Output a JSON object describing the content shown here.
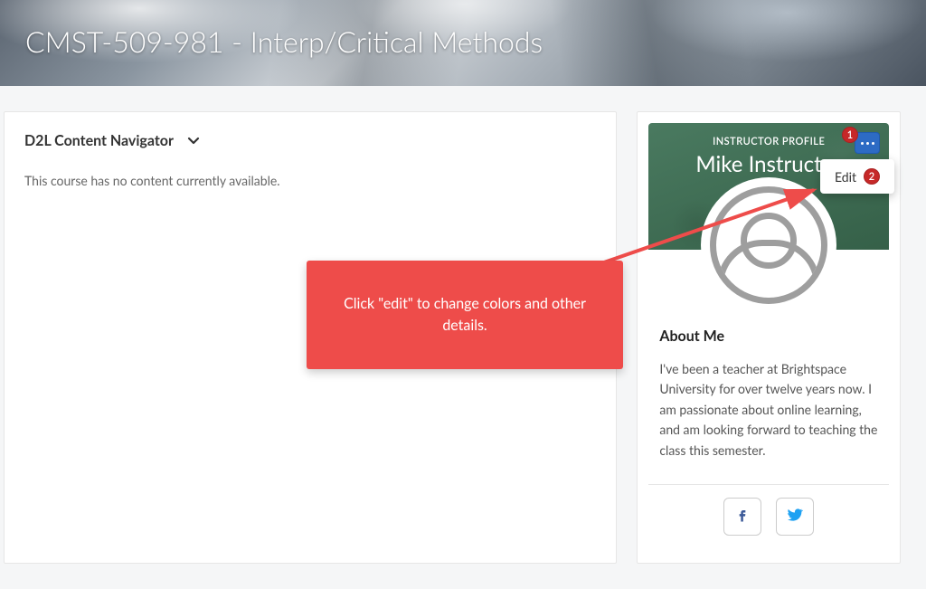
{
  "banner": {
    "title": "CMST-509-981 - Interp/Critical Methods"
  },
  "content_nav": {
    "title": "D2L Content Navigator",
    "empty_message": "This course has no content currently available."
  },
  "profile": {
    "label": "INSTRUCTOR PROFILE",
    "name": "Mike Instructor",
    "edit_label": "Edit",
    "badge_1": "1",
    "badge_2": "2",
    "about_title": "About Me",
    "about_text": "I've been a teacher at Brightspace University for over twelve years now. I am passionate about online learning, and am looking forward to teaching the class this semester."
  },
  "callout": {
    "text": "Click \"edit\" to change colors and other details."
  }
}
